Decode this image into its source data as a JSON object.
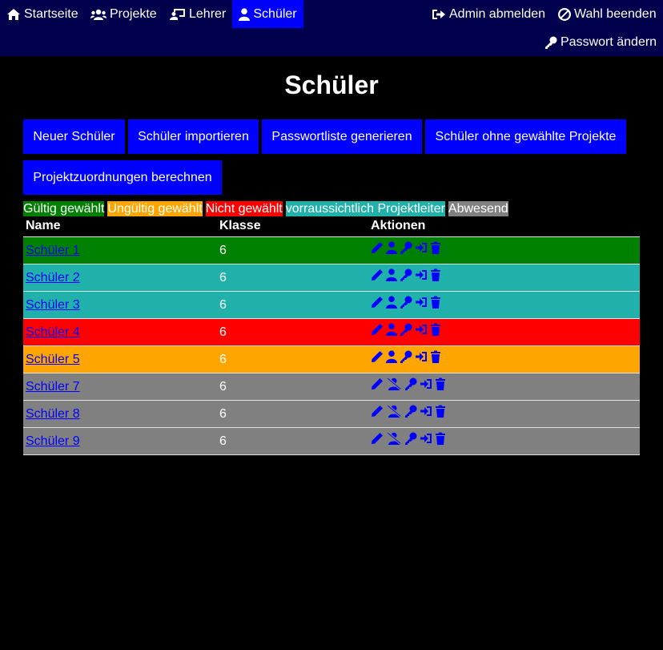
{
  "nav": {
    "home": "Startseite",
    "projects": "Projekte",
    "teachers": "Lehrer",
    "students": "Schüler",
    "logout": "Admin abmelden",
    "end_vote": "Wahl beenden",
    "change_password": "Passwort ändern"
  },
  "page_title": "Schüler",
  "buttons": {
    "new_student": "Neuer Schüler",
    "import_students": "Schüler importieren",
    "password_list": "Passwortliste generieren",
    "students_without_choice": "Schüler ohne gewählte Projekte",
    "compute_assignments": "Projektzuordnungen berechnen"
  },
  "legend": [
    {
      "label": "Gültig gewählt",
      "color": "#008000"
    },
    {
      "label": "Ungültig gewählt",
      "color": "#ffa500"
    },
    {
      "label": "Nicht gewählt",
      "color": "#ff0000"
    },
    {
      "label": "vorraussichtlich Projektleiter",
      "color": "#20b2aa"
    },
    {
      "label": "Abwesend",
      "color": "#808080"
    }
  ],
  "table": {
    "headers": {
      "name": "Name",
      "class": "Klasse",
      "actions": "Aktionen"
    },
    "rows": [
      {
        "name": "Schüler 1",
        "class": "6",
        "color": "#008000",
        "present": true
      },
      {
        "name": "Schüler 2",
        "class": "6",
        "color": "#20b2aa",
        "present": true
      },
      {
        "name": "Schüler 3",
        "class": "6",
        "color": "#20b2aa",
        "present": true
      },
      {
        "name": "Schüler 4",
        "class": "6",
        "color": "#ff0000",
        "present": true
      },
      {
        "name": "Schüler 5",
        "class": "6",
        "color": "#ffa500",
        "present": true
      },
      {
        "name": "Schüler 7",
        "class": "6",
        "color": "#808080",
        "present": false
      },
      {
        "name": "Schüler 8",
        "class": "6",
        "color": "#808080",
        "present": false
      },
      {
        "name": "Schüler 9",
        "class": "6",
        "color": "#808080",
        "present": false
      }
    ]
  }
}
